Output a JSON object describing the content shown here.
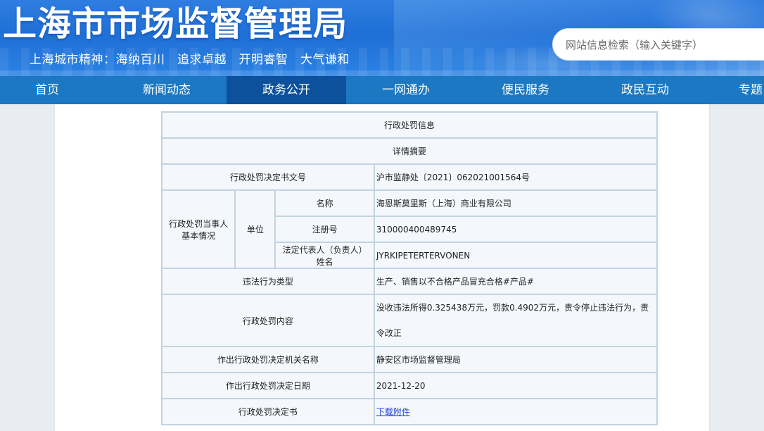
{
  "header": {
    "site_title": "上海市市场监督管理局",
    "slogan": "上海城市精神：海纳百川　追求卓越　开明睿智　大气谦和",
    "search_placeholder": "网站信息检索（输入关键字）"
  },
  "nav": {
    "items": [
      {
        "label": "首页",
        "active": false
      },
      {
        "label": "新闻动态",
        "active": false
      },
      {
        "label": "政务公开",
        "active": true
      },
      {
        "label": "一网通办",
        "active": false
      },
      {
        "label": "便民服务",
        "active": false
      },
      {
        "label": "政民互动",
        "active": false
      },
      {
        "label": "专题",
        "active": false
      }
    ]
  },
  "table": {
    "title": "行政处罚信息",
    "subtitle": "详情摘要",
    "decision_no_label": "行政处罚决定书文号",
    "decision_no_value": "沪市监静处〔2021〕062021001564号",
    "party_label": "行政处罚当事人基本情况",
    "party_type_label": "单位",
    "name_label": "名称",
    "name_value": "海恩斯莫里斯（上海）商业有限公司",
    "reg_label": "注册号",
    "reg_value": "310000400489745",
    "rep_label": "法定代表人（负责人）姓名",
    "rep_value": "JYRKIPETERTERVONEN",
    "violation_label": "违法行为类型",
    "violation_value": "生产、销售以不合格产品冒充合格#产品#",
    "content_label": "行政处罚内容",
    "content_value": "没收违法所得0.325438万元，罚款0.4902万元，责令停止违法行为，责令改正",
    "authority_label": "作出行政处罚决定机关名称",
    "authority_value": "静安区市场监督管理局",
    "date_label": "作出行政处罚决定日期",
    "date_value": "2021-12-20",
    "document_label": "行政处罚决定书",
    "document_link": "下载附件"
  }
}
